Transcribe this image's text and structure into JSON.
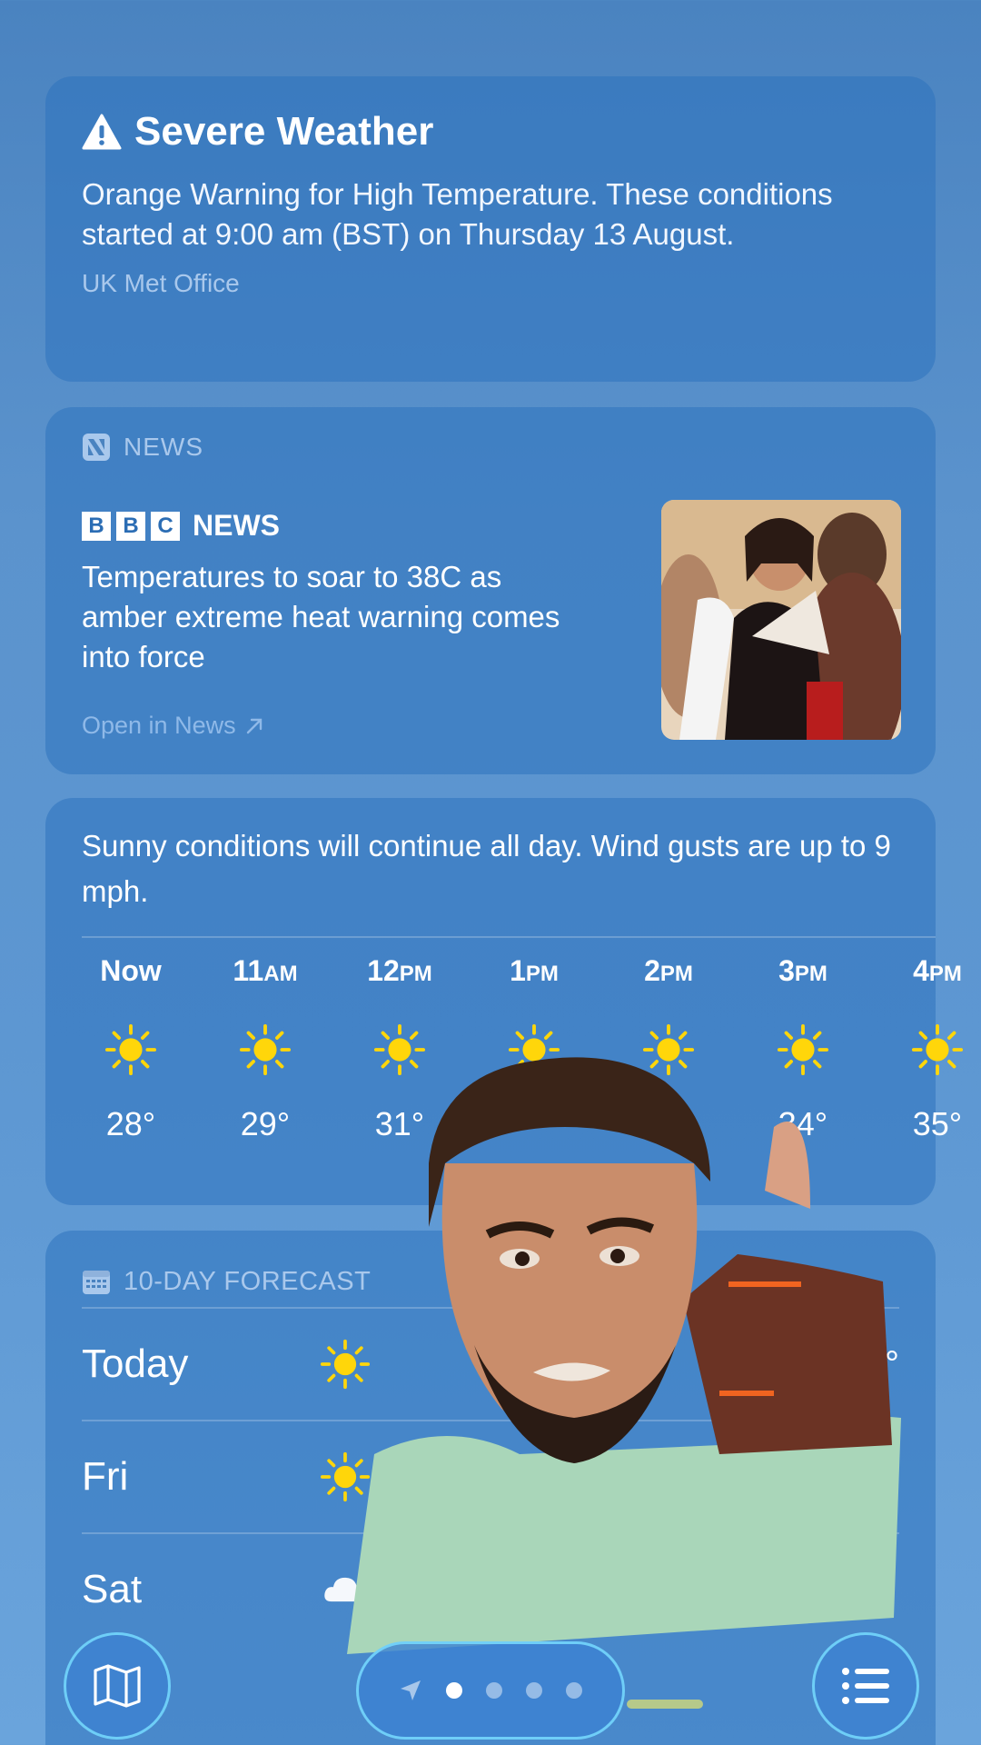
{
  "alert": {
    "title": "Severe Weather",
    "icon": "warning-triangle-icon",
    "body": "Orange Warning for High Temperature. These conditions started at 9:00 am (BST) on Thursday 13 August.",
    "source": "UK Met Office"
  },
  "news": {
    "section_label": "NEWS",
    "publisher_boxes": [
      "B",
      "B",
      "C"
    ],
    "publisher_word": "NEWS",
    "headline": "Temperatures to soar to 38C as amber extreme heat warning comes into force",
    "link_label": "Open in News"
  },
  "hourly": {
    "summary": "Sunny conditions will continue all day. Wind gusts are up to 9 mph.",
    "hours": [
      {
        "num": "Now",
        "suffix": "",
        "temp": "28°",
        "icon": "sun-icon"
      },
      {
        "num": "11",
        "suffix": "AM",
        "temp": "29°",
        "icon": "sun-icon"
      },
      {
        "num": "12",
        "suffix": "PM",
        "temp": "31°",
        "icon": "sun-icon"
      },
      {
        "num": "1",
        "suffix": "PM",
        "temp": "",
        "icon": "sun-icon"
      },
      {
        "num": "2",
        "suffix": "PM",
        "temp": "",
        "icon": "sun-icon"
      },
      {
        "num": "3",
        "suffix": "PM",
        "temp": "34°",
        "icon": "sun-icon"
      },
      {
        "num": "4",
        "suffix": "PM",
        "temp": "35°",
        "icon": "sun-icon"
      }
    ]
  },
  "forecast": {
    "header": "10-DAY FORECAST",
    "days": [
      {
        "day": "Today",
        "icon": "sun-icon",
        "high": "35°"
      },
      {
        "day": "Fri",
        "icon": "sun-icon",
        "high": ""
      },
      {
        "day": "Sat",
        "icon": "cloud-icon",
        "high": ""
      }
    ]
  },
  "nav": {
    "map_icon": "map-icon",
    "list_icon": "list-icon",
    "pages": 4,
    "active_page": 1
  },
  "colors": {
    "sun": "#ffd60a",
    "accent_link": "#8fb9e8",
    "ring": "#78dcff"
  }
}
